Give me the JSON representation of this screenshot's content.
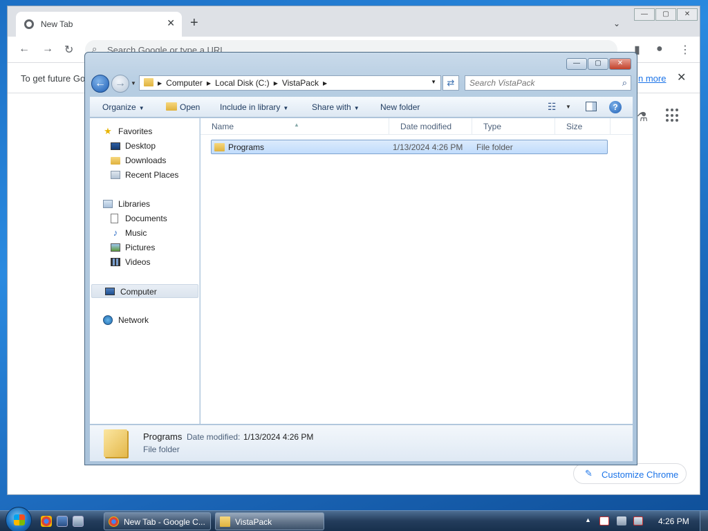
{
  "chrome": {
    "tab_title": "New Tab",
    "omnibox_placeholder": "Search Google or type a URL",
    "infobar_message": "To get future Go",
    "infobar_link": "n more",
    "customize_label": "Customize Chrome"
  },
  "explorer": {
    "breadcrumbs": [
      "Computer",
      "Local Disk (C:)",
      "VistaPack"
    ],
    "search_placeholder": "Search VistaPack",
    "toolbar": {
      "organize": "Organize",
      "open": "Open",
      "include_in_library": "Include in library",
      "share_with": "Share with",
      "new_folder": "New folder"
    },
    "nav": {
      "favorites": "Favorites",
      "desktop": "Desktop",
      "downloads": "Downloads",
      "recent_places": "Recent Places",
      "libraries": "Libraries",
      "documents": "Documents",
      "music": "Music",
      "pictures": "Pictures",
      "videos": "Videos",
      "computer": "Computer",
      "network": "Network"
    },
    "columns": {
      "name": "Name",
      "date_modified": "Date modified",
      "type": "Type",
      "size": "Size"
    },
    "files": [
      {
        "name": "Programs",
        "date_modified": "1/13/2024 4:26 PM",
        "type": "File folder",
        "size": ""
      }
    ],
    "details": {
      "name": "Programs",
      "date_label": "Date modified:",
      "date_value": "1/13/2024 4:26 PM",
      "type": "File folder"
    }
  },
  "taskbar": {
    "chrome_button": "New Tab - Google C...",
    "explorer_button": "VistaPack",
    "clock": "4:26 PM"
  },
  "colors": {
    "selection": "#c1dcfc",
    "accent_link": "#1a73e8",
    "taskbar": "#243d5c"
  }
}
